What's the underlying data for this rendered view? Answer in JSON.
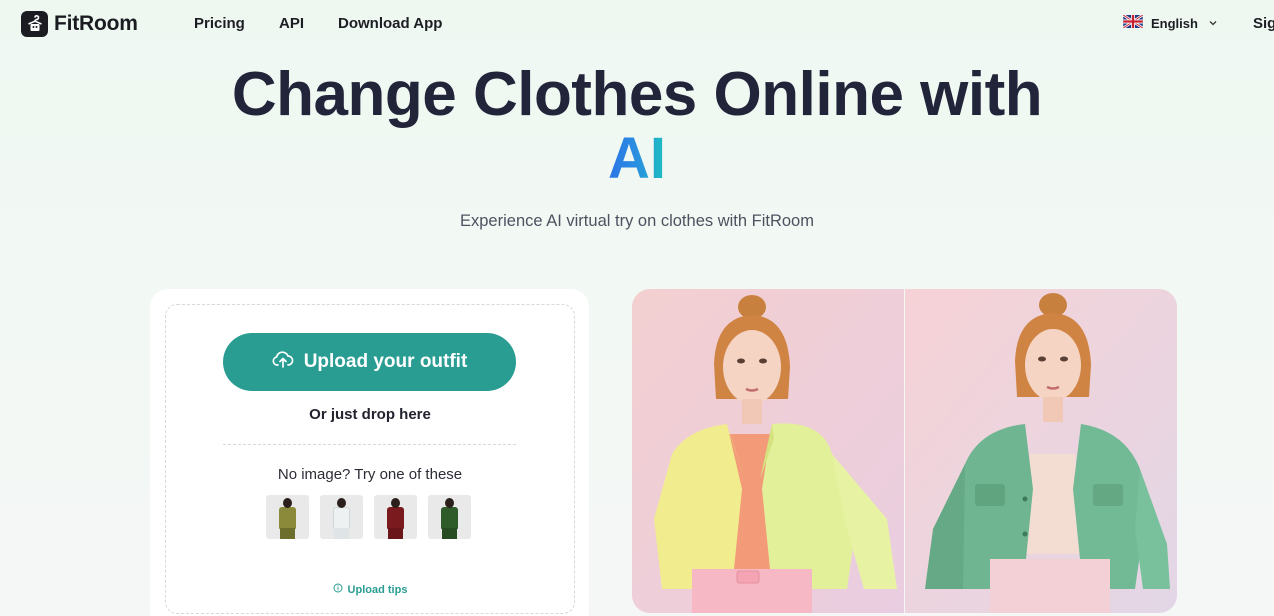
{
  "nav": {
    "logo_text": "FitRoom",
    "links": [
      "Pricing",
      "API",
      "Download App"
    ],
    "language": "English",
    "signin_label": "Sig"
  },
  "hero": {
    "title_line1": "Change Clothes Online with",
    "title_ai": "AI",
    "subtitle": "Experience AI virtual try on clothes with FitRoom"
  },
  "upload": {
    "button_label": "Upload your outfit",
    "drop_text": "Or just drop here",
    "try_text": "No image? Try one of these",
    "samples": [
      {
        "name": "olive-outfit",
        "top": "#8a8a3a",
        "bottom": "#6d6d2c"
      },
      {
        "name": "white-outfit",
        "top": "#eef1f2",
        "bottom": "#dfe4e6"
      },
      {
        "name": "red-outfit",
        "top": "#7a1a1f",
        "bottom": "#6a1519"
      },
      {
        "name": "green-outfit",
        "top": "#2f5a2a",
        "bottom": "#274b23"
      }
    ],
    "tips_label": "Upload tips"
  },
  "colors": {
    "accent": "#2a9d93",
    "ai_gradient_start": "#2b74e6",
    "ai_gradient_end": "#1bc0c0"
  },
  "icons": {
    "upload_icon": "cloud-upload-icon",
    "tips_icon": "info-circle-icon",
    "language_icon": "uk-flag-icon",
    "chevron_icon": "chevron-down-icon"
  }
}
